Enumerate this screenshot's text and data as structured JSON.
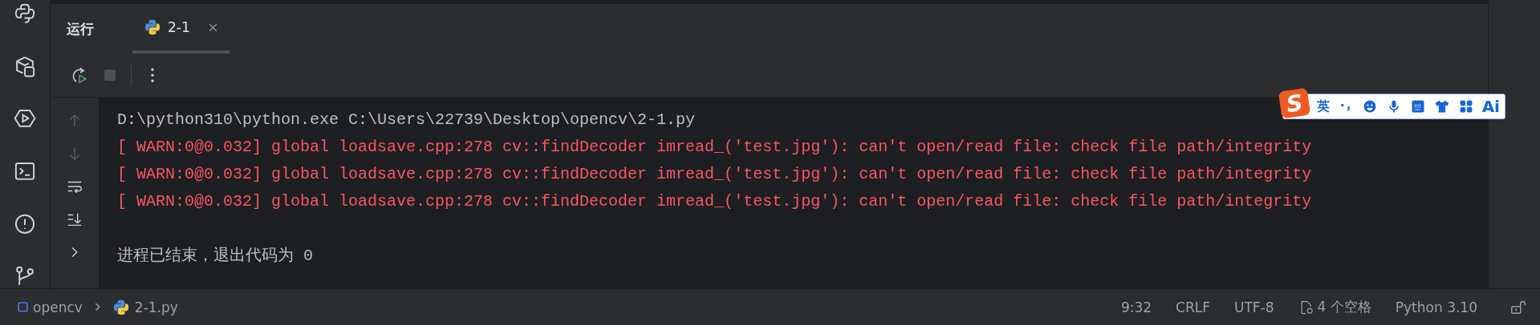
{
  "tool_window": {
    "title": "运行",
    "tabs": [
      {
        "label": "2-1",
        "selected": true
      }
    ]
  },
  "toolbar": {
    "stop_disabled": true
  },
  "gutter": [
    {
      "kind": "up",
      "disabled": true
    },
    {
      "kind": "down",
      "disabled": true
    },
    {
      "kind": "wrap",
      "disabled": false
    },
    {
      "kind": "scroll_end",
      "disabled": false
    },
    {
      "kind": "expand",
      "disabled": false
    }
  ],
  "console": [
    {
      "kind": "command",
      "text": "D:\\python310\\python.exe C:\\Users\\22739\\Desktop\\opencv\\2-1.py"
    },
    {
      "kind": "warning",
      "text": "[ WARN:0@0.032] global loadsave.cpp:278 cv::findDecoder imread_('test.jpg'): can't open/read file: check file path/integrity"
    },
    {
      "kind": "warning",
      "text": "[ WARN:0@0.032] global loadsave.cpp:278 cv::findDecoder imread_('test.jpg'): can't open/read file: check file path/integrity"
    },
    {
      "kind": "warning",
      "text": "[ WARN:0@0.032] global loadsave.cpp:278 cv::findDecoder imread_('test.jpg'): can't open/read file: check file path/integrity"
    },
    {
      "kind": "blank"
    },
    {
      "kind": "info",
      "text": "进程已结束，退出代码为 0"
    }
  ],
  "ime_toolbar": {
    "logo": "S",
    "language": "英",
    "ai": "Ai"
  },
  "status_bar": {
    "breadcrumbs": [
      {
        "kind": "project",
        "label": "opencv"
      },
      {
        "kind": "file",
        "label": "2-1.py"
      }
    ],
    "items": [
      {
        "kind": "position",
        "label": "9:32"
      },
      {
        "kind": "line_separator",
        "label": "CRLF"
      },
      {
        "kind": "encoding",
        "label": "UTF-8"
      },
      {
        "kind": "indent",
        "label": "4 个空格"
      },
      {
        "kind": "interpreter",
        "label": "Python 3.10"
      }
    ],
    "read_only": false
  }
}
